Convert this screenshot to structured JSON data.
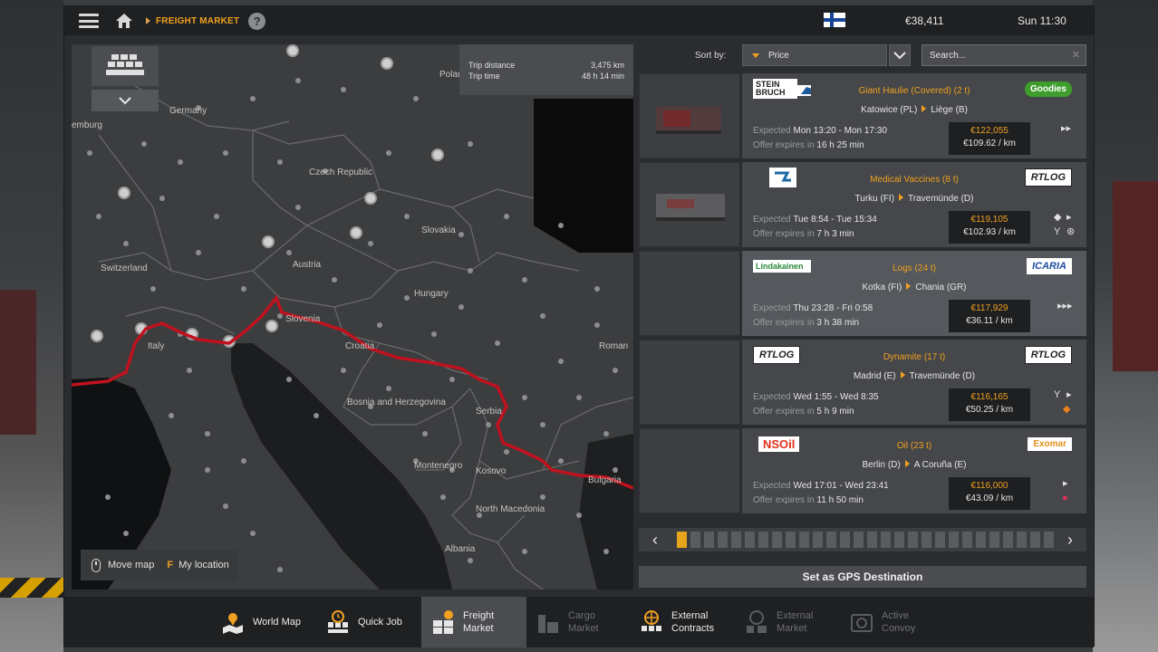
{
  "topbar": {
    "breadcrumb": "FREIGHT MARKET",
    "help": "?",
    "money": "€38,411",
    "clock": "Sun 11:30"
  },
  "map": {
    "trip": {
      "distance_label": "Trip distance",
      "distance_value": "3,475 km",
      "time_label": "Trip time",
      "time_value": "48 h 14 min"
    },
    "labels": [
      "Germany",
      "emburg",
      "Polan",
      "Czech Republic",
      "Slovakia",
      "Switzerland",
      "Austria",
      "Hungary",
      "Slovenia",
      "Italy",
      "Croatia",
      "Roman",
      "Bosnia and Herzegovina",
      "Serbia",
      "Montenegro",
      "Kosovo",
      "Bulgaria",
      "North Macedonia",
      "Albania"
    ],
    "hint_move": "Move map",
    "hint_key": "F",
    "hint_location": "My location"
  },
  "sort": {
    "label": "Sort by:",
    "selected": "Price",
    "search_placeholder": "Search..."
  },
  "jobs": [
    {
      "company": "STEIN BRUCH",
      "client": "Goodies",
      "cargo": "Giant Haulie (Covered) (2 t)",
      "from": "Katowice (PL)",
      "to": "Liège (B)",
      "expected_label": "Expected",
      "expected": "Mon 13:20 - Mon 17:30",
      "expires_label": "Offer expires in",
      "expires": "16 h 25 min",
      "price": "€122,055",
      "per_km": "€109.62 / km",
      "selected": false
    },
    {
      "company": "",
      "client": "RTLOG",
      "cargo": "Medical Vaccines (8 t)",
      "from": "Turku (FI)",
      "to": "Travemünde (D)",
      "expected_label": "Expected",
      "expected": "Tue 8:54 - Tue 15:34",
      "expires_label": "Offer expires in",
      "expires": "7 h 3 min",
      "price": "€119,105",
      "per_km": "€102.93 / km",
      "selected": false
    },
    {
      "company": "Lindakainen",
      "client": "ICARIA",
      "cargo": "Logs (24 t)",
      "from": "Kotka (FI)",
      "to": "Chania (GR)",
      "expected_label": "Expected",
      "expected": "Thu 23:28 - Fri 0:58",
      "expires_label": "Offer expires in",
      "expires": "3 h 38 min",
      "price": "€117,929",
      "per_km": "€36.11 / km",
      "selected": true
    },
    {
      "company": "RTLOG",
      "client": "RTLOG",
      "cargo": "Dynamite (17 t)",
      "from": "Madrid (E)",
      "to": "Travemünde (D)",
      "expected_label": "Expected",
      "expected": "Wed 1:55 - Wed 8:35",
      "expires_label": "Offer expires in",
      "expires": "5 h 9 min",
      "price": "€116,165",
      "per_km": "€50.25 / km",
      "selected": false
    },
    {
      "company": "NSOil",
      "client": "Exomar",
      "cargo": "Oil (23 t)",
      "from": "Berlin (D)",
      "to": "A Coruña (E)",
      "expected_label": "Expected",
      "expected": "Wed 17:01 - Wed 23:41",
      "expires_label": "Offer expires in",
      "expires": "11 h 50 min",
      "price": "€116,000",
      "per_km": "€43.09 / km",
      "selected": false
    }
  ],
  "pager": {
    "pages": 28,
    "current": 1
  },
  "gps_button": "Set as GPS Destination",
  "bottomnav": {
    "world_map": "World Map",
    "quick_job": "Quick Job",
    "freight_market_1": "Freight",
    "freight_market_2": "Market",
    "cargo_market_1": "Cargo",
    "cargo_market_2": "Market",
    "external_contracts_1": "External",
    "external_contracts_2": "Contracts",
    "external_market_1": "External",
    "external_market_2": "Market",
    "active_convoy_1": "Active",
    "active_convoy_2": "Convoy"
  },
  "colors": {
    "accent": "#f0a020",
    "route": "#c0121e",
    "selected_page": "#e6a51a"
  }
}
